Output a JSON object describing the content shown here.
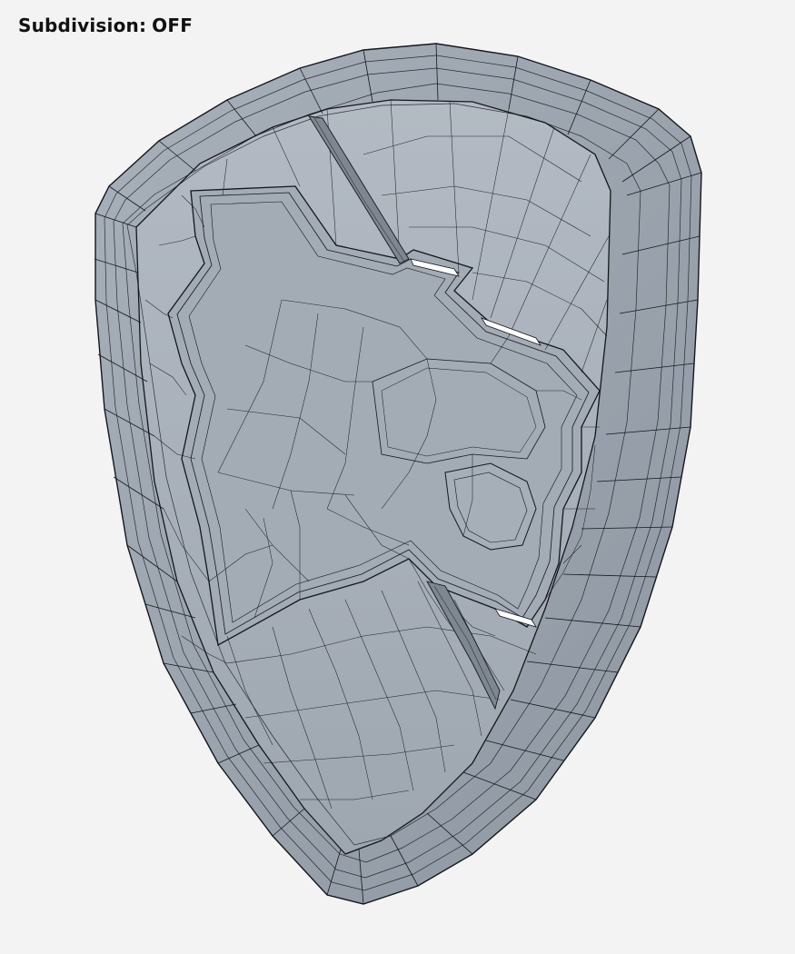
{
  "viewport": {
    "setting_label": "Subdivision:",
    "setting_value": "OFF",
    "background_color": "#f3f3f3"
  },
  "model": {
    "object": "shield-mesh",
    "display": "wireframe-on-shaded",
    "surface_color": "#9aa2ac",
    "inner_color": "#a9b0b9",
    "edge_color": "#14171c",
    "highlight_color": "#ffffff"
  }
}
